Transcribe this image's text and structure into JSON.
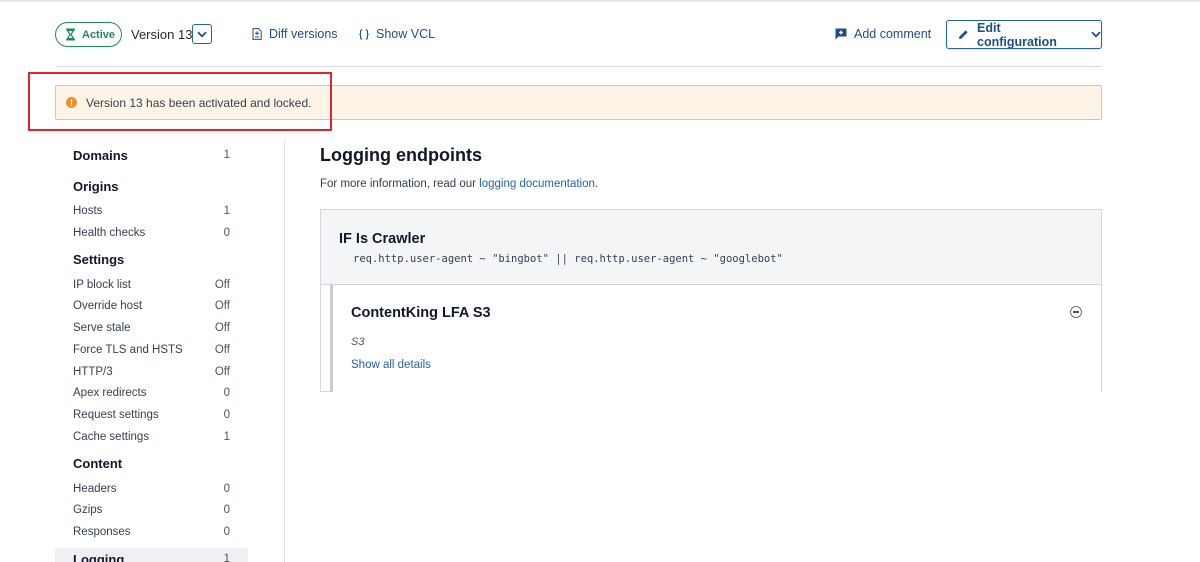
{
  "header": {
    "status": "Active",
    "version": "Version 13",
    "diff_label": "Diff versions",
    "vcl_label": "Show VCL",
    "comment_label": "Add comment",
    "edit_label": "Edit configuration"
  },
  "alert": {
    "message": "Version 13 has been activated and locked.",
    "icon": "warning-icon"
  },
  "sidebar": {
    "items": [
      {
        "label": "Domains",
        "value": "1",
        "group": true
      },
      {
        "label": "Origins",
        "value": "",
        "group": true
      },
      {
        "label": "Hosts",
        "value": "1",
        "group": false
      },
      {
        "label": "Health checks",
        "value": "0",
        "group": false
      },
      {
        "label": "Settings",
        "value": "",
        "group": true
      },
      {
        "label": "IP block list",
        "value": "Off",
        "group": false
      },
      {
        "label": "Override host",
        "value": "Off",
        "group": false
      },
      {
        "label": "Serve stale",
        "value": "Off",
        "group": false
      },
      {
        "label": "Force TLS and HSTS",
        "value": "Off",
        "group": false
      },
      {
        "label": "HTTP/3",
        "value": "Off",
        "group": false
      },
      {
        "label": "Apex redirects",
        "value": "0",
        "group": false
      },
      {
        "label": "Request settings",
        "value": "0",
        "group": false
      },
      {
        "label": "Cache settings",
        "value": "1",
        "group": false
      },
      {
        "label": "Content",
        "value": "",
        "group": true
      },
      {
        "label": "Headers",
        "value": "0",
        "group": false
      },
      {
        "label": "Gzips",
        "value": "0",
        "group": false
      },
      {
        "label": "Responses",
        "value": "0",
        "group": false
      },
      {
        "label": "Logging",
        "value": "1",
        "group": true,
        "active": true
      }
    ]
  },
  "main": {
    "title": "Logging endpoints",
    "info_prefix": "For more information, read our ",
    "info_link": "logging documentation",
    "info_suffix": ".",
    "condition": {
      "title": "IF Is Crawler",
      "code": "req.http.user-agent ~ \"bingbot\" || req.http.user-agent ~ \"googlebot\""
    },
    "endpoint": {
      "name": "ContentKing LFA S3",
      "type": "S3",
      "details_link": "Show all details"
    }
  },
  "colors": {
    "accent": "#2563a8",
    "active_green": "#1f8a5c",
    "alert_bg": "#fdf3e6",
    "alert_border": "#f0c27a",
    "highlight": "#e0242c"
  }
}
